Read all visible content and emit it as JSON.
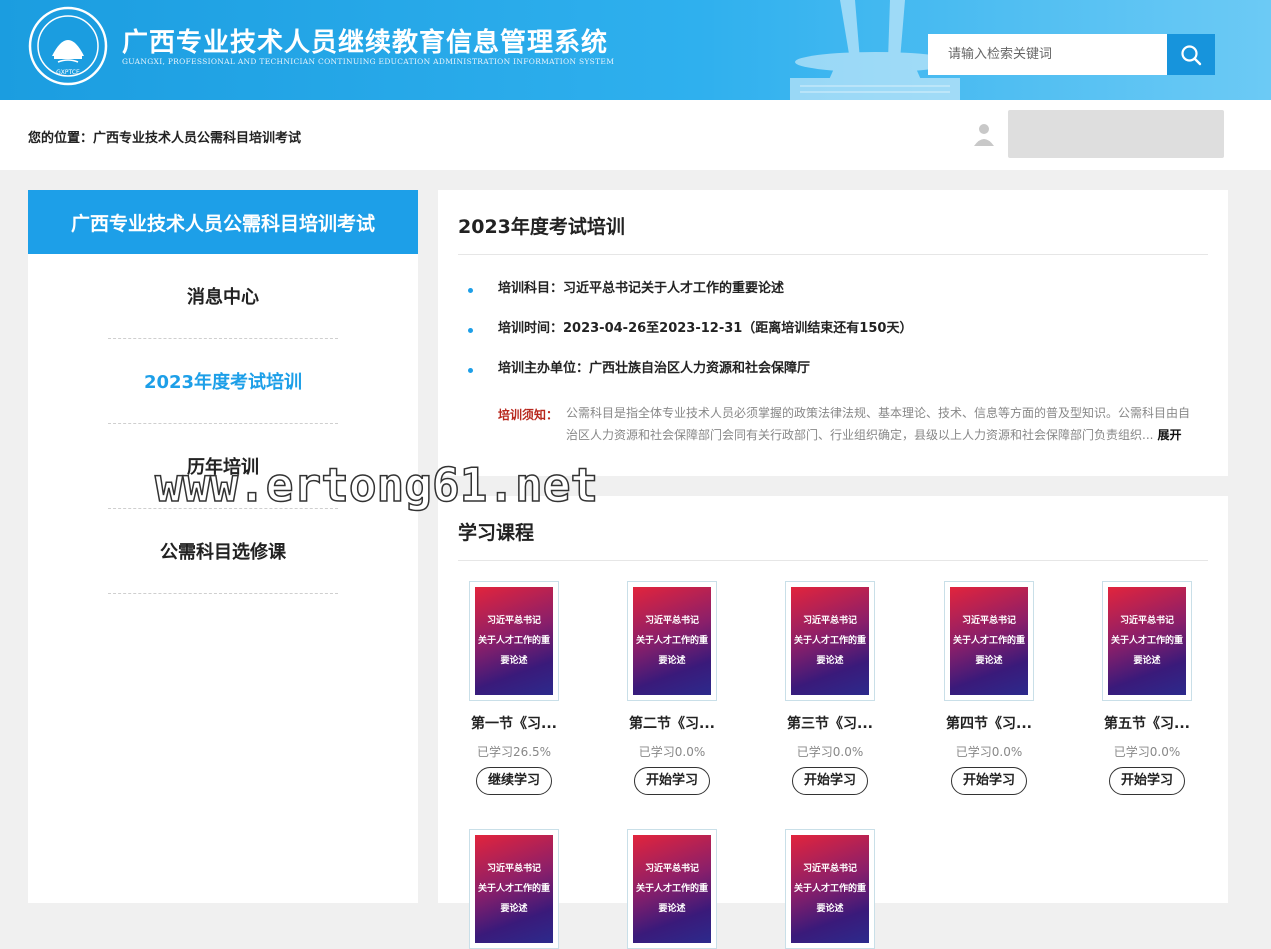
{
  "header": {
    "title": "广西专业技术人员继续教育信息管理系统",
    "subtitle": "GUANGXI, PROFESSIONAL AND TECHNICIAN CONTINUING EDUCATION ADMINISTRATION INFORMATION SYSTEM",
    "logo_text": "GXPTCE",
    "search_placeholder": "请输入检索关键词"
  },
  "breadcrumb": {
    "label": "您的位置：",
    "current": "广西专业技术人员公需科目培训考试"
  },
  "sidebar": {
    "heading": "广西专业技术人员公需科目培训考试",
    "items": [
      {
        "label": "消息中心",
        "active": false
      },
      {
        "label": "2023年度考试培训",
        "active": true
      },
      {
        "label": "历年培训",
        "active": false
      },
      {
        "label": "公需科目选修课",
        "active": false
      }
    ]
  },
  "training": {
    "title": "2023年度考试培训",
    "subject": "培训科目：习近平总书记关于人才工作的重要论述",
    "period": "培训时间：2023-04-26至2023-12-31（距离培训结束还有150天）",
    "organizer": "培训主办单位：广西壮族自治区人力资源和社会保障厅",
    "notice_label": "培训须知：",
    "notice_text": "公需科目是指全体专业技术人员必须掌握的政策法律法规、基本理论、技术、信息等方面的普及型知识。公需科目由自治区人力资源和社会保障部门会同有关行政部门、行业组织确定，县级以上人力资源和社会保障部门负责组织...",
    "expand": "展开"
  },
  "courses_section": {
    "title": "学习课程",
    "cover_line1": "习近平总书记",
    "cover_line2": "关于人才工作的重要论述",
    "courses": [
      {
        "title": "第一节《习...",
        "progress": "已学习26.5%",
        "action": "继续学习"
      },
      {
        "title": "第二节《习...",
        "progress": "已学习0.0%",
        "action": "开始学习"
      },
      {
        "title": "第三节《习...",
        "progress": "已学习0.0%",
        "action": "开始学习"
      },
      {
        "title": "第四节《习...",
        "progress": "已学习0.0%",
        "action": "开始学习"
      },
      {
        "title": "第五节《习...",
        "progress": "已学习0.0%",
        "action": "开始学习"
      }
    ]
  },
  "watermark": "www.ertong61.net",
  "colors": {
    "accent": "#1d9fe8",
    "header_bg": "#2fb0ee",
    "notice_label": "#b8281e"
  }
}
